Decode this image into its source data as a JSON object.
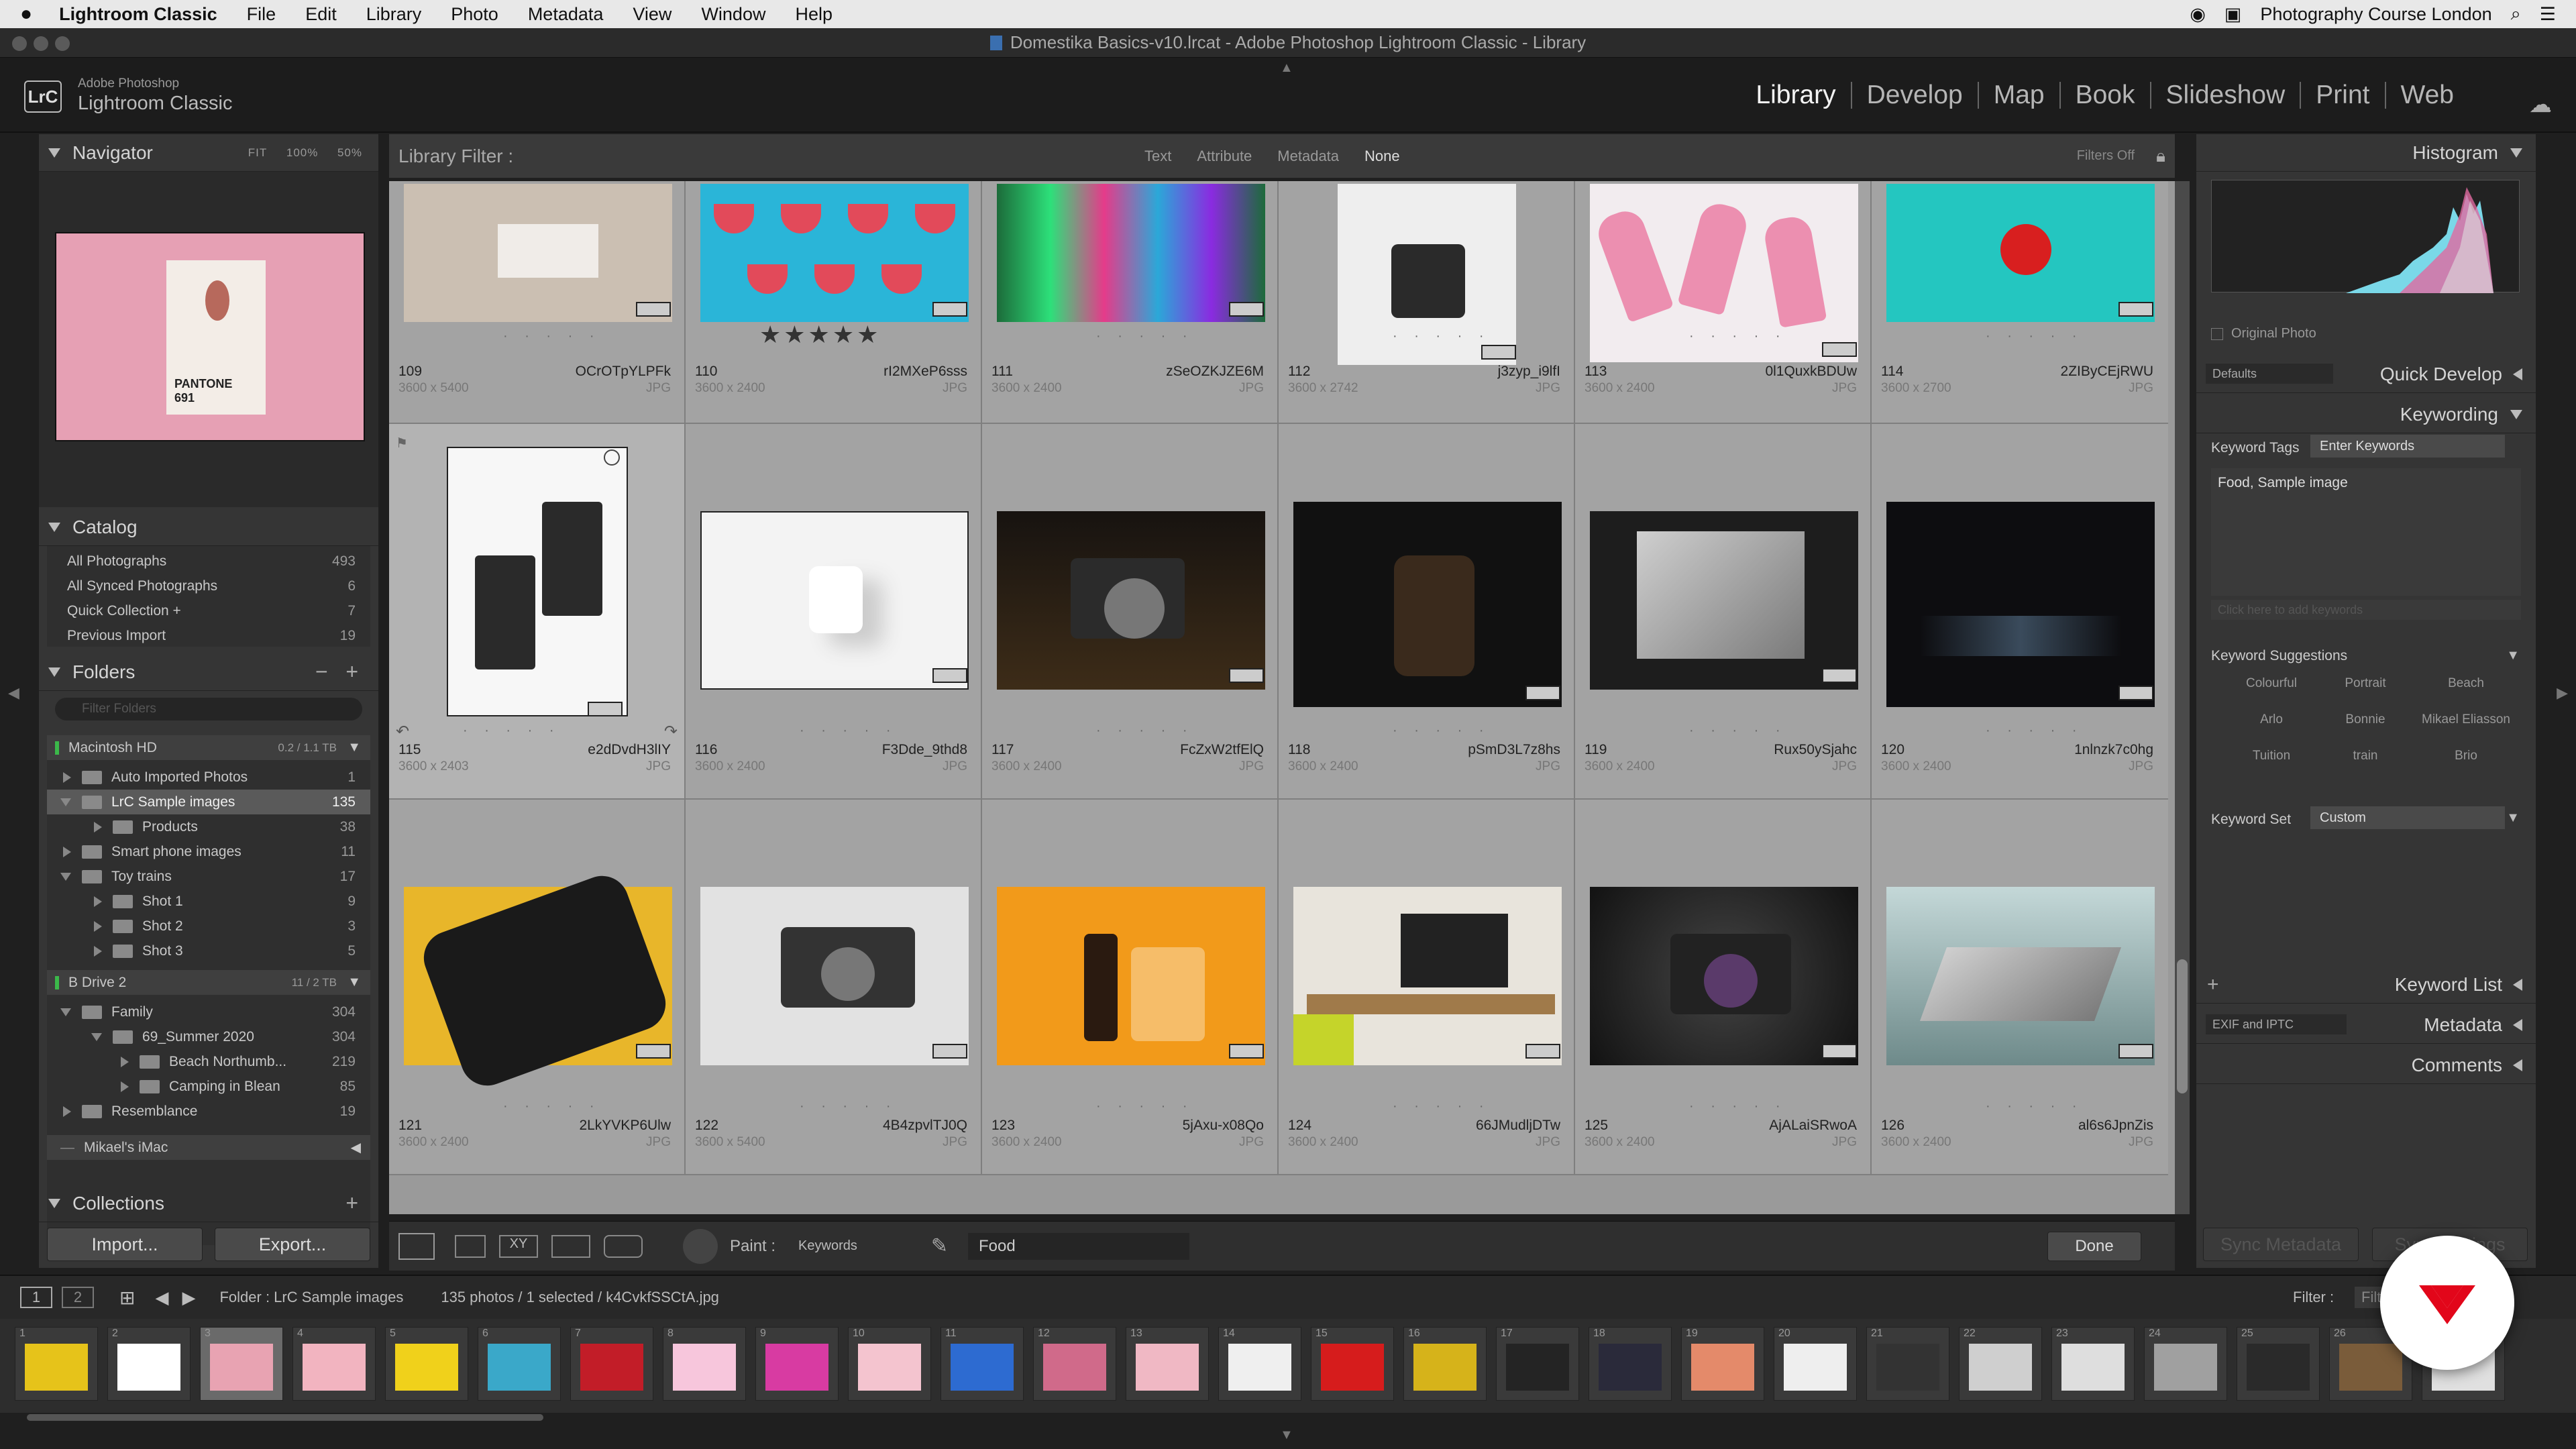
{
  "menubar": {
    "app": "Lightroom Classic",
    "items": [
      "File",
      "Edit",
      "Library",
      "Photo",
      "Metadata",
      "View",
      "Window",
      "Help"
    ],
    "right_text": "Photography Course London"
  },
  "window": {
    "title": "Domestika Basics-v10.lrcat - Adobe Photoshop Lightroom Classic - Library"
  },
  "identity": {
    "logo": "LrC",
    "line1": "Adobe Photoshop",
    "line2": "Lightroom Classic"
  },
  "modules": [
    "Library",
    "Develop",
    "Map",
    "Book",
    "Slideshow",
    "Print",
    "Web"
  ],
  "navigator": {
    "title": "Navigator",
    "zoom": [
      "FIT",
      "100%",
      "50%"
    ],
    "preview_text": "PANTONE 691"
  },
  "catalog": {
    "title": "Catalog",
    "items": [
      {
        "label": "All Photographs",
        "count": "493"
      },
      {
        "label": "All Synced Photographs",
        "count": "6"
      },
      {
        "label": "Quick Collection +",
        "count": "7"
      },
      {
        "label": "Previous Import",
        "count": "19"
      }
    ]
  },
  "folders": {
    "title": "Folders",
    "filter_placeholder": "Filter Folders",
    "volume1": {
      "label": "Macintosh HD",
      "info": "0.2 / 1.1 TB"
    },
    "items": [
      {
        "label": "Auto Imported Photos",
        "count": "1"
      },
      {
        "label": "LrC Sample images",
        "count": "135"
      },
      {
        "label": "Products",
        "count": "38"
      },
      {
        "label": "Smart phone images",
        "count": "11"
      },
      {
        "label": "Toy trains",
        "count": "17"
      },
      {
        "label": "Shot 1",
        "count": "9"
      },
      {
        "label": "Shot 2",
        "count": "3"
      },
      {
        "label": "Shot 3",
        "count": "5"
      }
    ],
    "volume2": {
      "label": "B Drive 2",
      "info": "11 / 2 TB"
    },
    "items2": [
      {
        "label": "Family",
        "count": "304"
      },
      {
        "label": "69_Summer 2020",
        "count": "304"
      },
      {
        "label": "Beach Northumb...",
        "count": "219"
      },
      {
        "label": "Camping in Blean",
        "count": "85"
      },
      {
        "label": "Resemblance",
        "count": "19"
      }
    ],
    "volume3": {
      "label": "Mikael's iMac"
    }
  },
  "collections": {
    "title": "Collections"
  },
  "buttons": {
    "import": "Import...",
    "export": "Export..."
  },
  "filterbar": {
    "label": "Library Filter :",
    "tabs": [
      "Text",
      "Attribute",
      "Metadata",
      "None"
    ],
    "right": "Filters Off"
  },
  "grid": {
    "row1": [
      {
        "idx": "109",
        "name": "OCrOTpYLPFk",
        "dims": "3600 x 5400",
        "ext": "JPG"
      },
      {
        "idx": "110",
        "name": "rI2MXeP6sss",
        "dims": "3600 x 2400",
        "ext": "JPG",
        "stars": "★★★★★"
      },
      {
        "idx": "111",
        "name": "zSeOZKJZE6M",
        "dims": "3600 x 2400",
        "ext": "JPG"
      },
      {
        "idx": "112",
        "name": "j3zyp_i9lfI",
        "dims": "3600 x 2742",
        "ext": "JPG"
      },
      {
        "idx": "113",
        "name": "0l1QuxkBDUw",
        "dims": "3600 x 2400",
        "ext": "JPG"
      },
      {
        "idx": "114",
        "name": "2ZIByCEjRWU",
        "dims": "3600 x 2700",
        "ext": "JPG"
      }
    ],
    "row2": [
      {
        "idx": "115",
        "name": "e2dDvdH3lIY",
        "dims": "3600 x 2403",
        "ext": "JPG"
      },
      {
        "idx": "116",
        "name": "F3Dde_9thd8",
        "dims": "3600 x 2400",
        "ext": "JPG"
      },
      {
        "idx": "117",
        "name": "FcZxW2tfElQ",
        "dims": "3600 x 2400",
        "ext": "JPG"
      },
      {
        "idx": "118",
        "name": "pSmD3L7z8hs",
        "dims": "3600 x 2400",
        "ext": "JPG"
      },
      {
        "idx": "119",
        "name": "Rux50ySjahc",
        "dims": "3600 x 2400",
        "ext": "JPG"
      },
      {
        "idx": "120",
        "name": "1nlnzk7c0hg",
        "dims": "3600 x 2400",
        "ext": "JPG"
      }
    ],
    "row3": [
      {
        "idx": "121",
        "name": "2LkYVKP6Ulw",
        "dims": "3600 x 2400",
        "ext": "JPG"
      },
      {
        "idx": "122",
        "name": "4B4zpvlTJ0Q",
        "dims": "3600 x 5400",
        "ext": "JPG"
      },
      {
        "idx": "123",
        "name": "5jAxu-x08Qo",
        "dims": "3600 x 2400",
        "ext": "JPG"
      },
      {
        "idx": "124",
        "name": "66JMudljDTw",
        "dims": "3600 x 2400",
        "ext": "JPG"
      },
      {
        "idx": "125",
        "name": "AjALaiSRwoA",
        "dims": "3600 x 2400",
        "ext": "JPG"
      },
      {
        "idx": "126",
        "name": "al6s6JpnZis",
        "dims": "3600 x 2400",
        "ext": "JPG"
      }
    ]
  },
  "toolbar": {
    "paint_label": "Paint :",
    "paint_value": "Keywords",
    "keyword": "Food",
    "done": "Done"
  },
  "histogram": {
    "title": "Histogram",
    "original": "Original Photo"
  },
  "quickdevelop": {
    "title": "Quick Develop",
    "preset": "Defaults"
  },
  "keywording": {
    "title": "Keywording",
    "tags_label": "Keyword Tags",
    "tags_value": "Enter Keywords",
    "keywords": "Food, Sample image",
    "add_placeholder": "Click here to add keywords",
    "suggestions_title": "Keyword Suggestions",
    "suggestions": [
      "Colourful",
      "Portrait",
      "Beach",
      "Arlo",
      "Bonnie",
      "Mikael Eliasson",
      "Tuition",
      "train",
      "Brio"
    ],
    "set_label": "Keyword Set",
    "set_value": "Custom"
  },
  "keywordlist": {
    "title": "Keyword List"
  },
  "metadata": {
    "title": "Metadata",
    "preset": "EXIF and IPTC"
  },
  "comments": {
    "title": "Comments"
  },
  "syncbtns": {
    "meta": "Sync Metadata",
    "settings": "Sync Settings"
  },
  "filmbar": {
    "page1": "1",
    "page2": "2",
    "path": "Folder : LrC Sample images",
    "count": "135 photos / 1 selected / k4CvkfSSCtA.jpg",
    "filter": "Filter :",
    "filter_val": "Filte"
  },
  "film_numbers": [
    "1",
    "2",
    "3",
    "4",
    "5",
    "6",
    "7",
    "8",
    "9",
    "10",
    "11",
    "12",
    "13",
    "14",
    "15",
    "16",
    "17",
    "18",
    "19",
    "20",
    "21",
    "22",
    "23",
    "24",
    "25",
    "26",
    "27"
  ],
  "film_colors": [
    "#e6c31a",
    "#ffffff",
    "#e8a3b2",
    "#f2b4c0",
    "#f0d11b",
    "#3aa8c9",
    "#c21d28",
    "#f7c6dc",
    "#d83ba2",
    "#f4c4cf",
    "#2d6bd1",
    "#d06a8a",
    "#f0b8c4",
    "#efefef",
    "#d61c1c",
    "#d6b31a",
    "#242424",
    "#2a2a3a",
    "#e48a6a",
    "#eeeeee",
    "#333333",
    "#cfcfcf",
    "#dedede",
    "#a0a0a0",
    "#2a2a2a",
    "#7a5c3a",
    "#e0e0e0"
  ],
  "colors": {
    "accent": "#f2f2f2",
    "panel": "#353535",
    "grid": "#a3a3a3",
    "brand": "#e2061a"
  }
}
